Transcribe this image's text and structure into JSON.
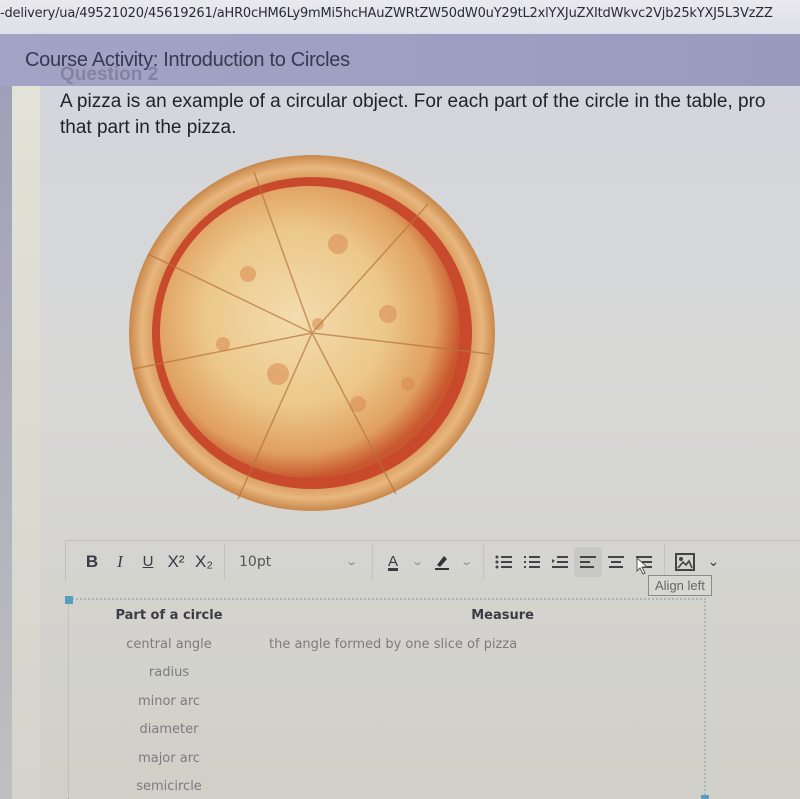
{
  "browser": {
    "url": "-delivery/ua/49521020/45619261/aHR0cHM6Ly9mMi5hcHAuZWRtZW50dW0uY29tL2xlYXJuZXItdWkvc2Vjb25kYXJ5L3VzZZ"
  },
  "header": {
    "title": "Course Activity: Introduction to Circles",
    "ghost_label": "Question 2"
  },
  "question": {
    "prompt_line1": "A pizza is an example of a circular object. For each part of the circle in the table, pro",
    "prompt_line2": "that part in the pizza.",
    "image_alt": "pizza"
  },
  "toolbar": {
    "bold": "B",
    "italic": "I",
    "underline": "U",
    "superscript": "X²",
    "subscript": "X₂",
    "font_size": "10pt",
    "font_color": "A",
    "tooltip": "Align left"
  },
  "table": {
    "headers": [
      "Part of a circle",
      "Measure"
    ],
    "rows": [
      {
        "part": "central angle",
        "measure": "the angle formed by one slice of pizza"
      },
      {
        "part": "radius",
        "measure": ""
      },
      {
        "part": "minor arc",
        "measure": ""
      },
      {
        "part": "diameter",
        "measure": ""
      },
      {
        "part": "major arc",
        "measure": ""
      },
      {
        "part": "semicircle",
        "measure": ""
      }
    ]
  }
}
